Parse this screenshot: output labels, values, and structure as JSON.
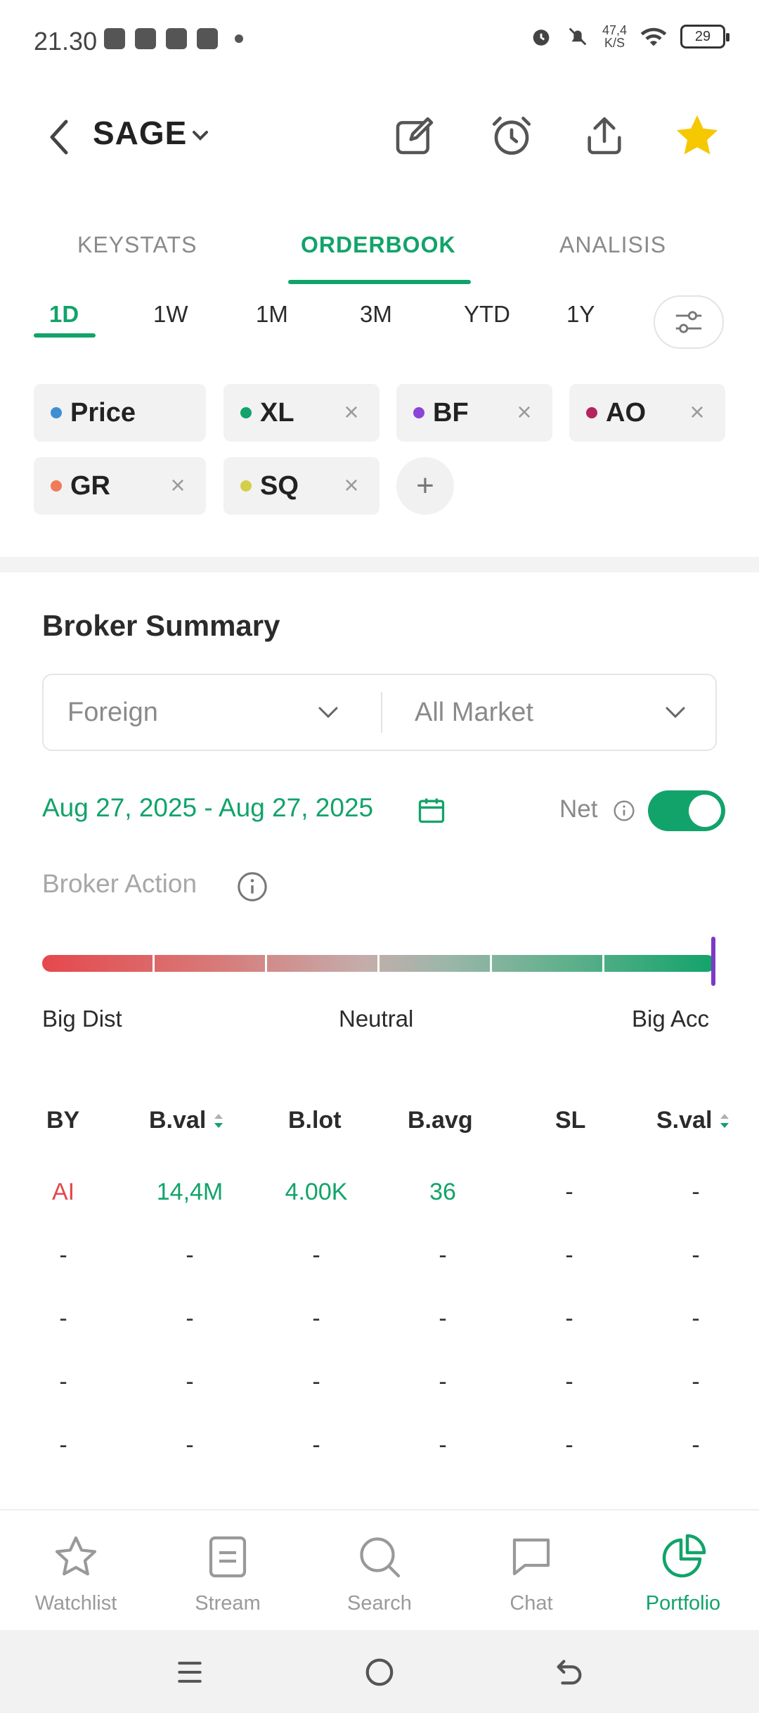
{
  "status_bar": {
    "time": "21.30",
    "net_speed_value": "47,4",
    "net_speed_unit": "K/S",
    "battery": "29"
  },
  "header": {
    "ticker": "SAGE"
  },
  "tabs": [
    {
      "label": "KEYSTATS",
      "active": false
    },
    {
      "label": "ORDERBOOK",
      "active": true
    },
    {
      "label": "ANALISIS",
      "active": false
    }
  ],
  "periods": [
    {
      "label": "1D",
      "active": true
    },
    {
      "label": "1W",
      "active": false
    },
    {
      "label": "1M",
      "active": false
    },
    {
      "label": "3M",
      "active": false
    },
    {
      "label": "YTD",
      "active": false
    },
    {
      "label": "1Y",
      "active": false
    }
  ],
  "chips": [
    {
      "label": "Price",
      "color": "#3d8fd1",
      "closable": false
    },
    {
      "label": "XL",
      "color": "#12a36a",
      "closable": true
    },
    {
      "label": "BF",
      "color": "#8b45d6",
      "closable": true
    },
    {
      "label": "AO",
      "color": "#b5245f",
      "closable": true
    },
    {
      "label": "GR",
      "color": "#f07a5a",
      "closable": true
    },
    {
      "label": "SQ",
      "color": "#d4cf4a",
      "closable": true
    }
  ],
  "broker_summary": {
    "title": "Broker Summary",
    "filter_investor": "Foreign",
    "filter_market": "All Market",
    "date_range": "Aug 27, 2025 - Aug 27, 2025",
    "net_label": "Net",
    "net_enabled": true,
    "broker_action_label": "Broker Action",
    "scale_left": "Big Dist",
    "scale_mid": "Neutral",
    "scale_right": "Big Acc",
    "action_level": 1.0
  },
  "table": {
    "headers": [
      "BY",
      "B.val",
      "B.lot",
      "B.avg",
      "SL",
      "S.val"
    ],
    "rows": [
      [
        "AI",
        "14,4M",
        "4.00K",
        "36",
        "-",
        "-"
      ],
      [
        "-",
        "-",
        "-",
        "-",
        "-",
        "-"
      ],
      [
        "-",
        "-",
        "-",
        "-",
        "-",
        "-"
      ],
      [
        "-",
        "-",
        "-",
        "-",
        "-",
        "-"
      ],
      [
        "-",
        "-",
        "-",
        "-",
        "-",
        "-"
      ]
    ]
  },
  "bottom_nav": [
    {
      "label": "Watchlist",
      "icon": "star-outline-icon",
      "active": false
    },
    {
      "label": "Stream",
      "icon": "stream-icon",
      "active": false
    },
    {
      "label": "Search",
      "icon": "search-icon",
      "active": false
    },
    {
      "label": "Chat",
      "icon": "chat-icon",
      "active": false
    },
    {
      "label": "Portfolio",
      "icon": "portfolio-pie-icon",
      "active": true
    }
  ],
  "colors": {
    "accent": "#12a36a",
    "negative": "#e5484d",
    "favorite": "#f5c800"
  }
}
